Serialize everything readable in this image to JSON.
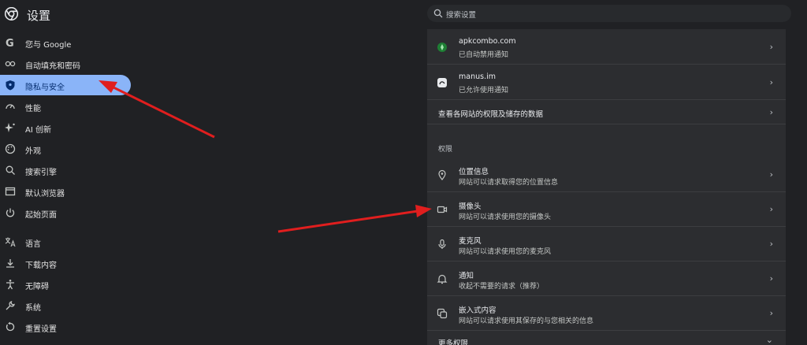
{
  "header": {
    "title": "设置",
    "logo": "chrome-logo"
  },
  "search": {
    "placeholder": "搜索设置"
  },
  "sidebar": {
    "items": [
      {
        "label": "您与 Google",
        "icon": "google-g-icon"
      },
      {
        "label": "自动填充和密码",
        "icon": "key-icon"
      },
      {
        "label": "隐私与安全",
        "icon": "shield-icon",
        "selected": true
      },
      {
        "label": "性能",
        "icon": "speedometer-icon"
      },
      {
        "label": "AI 创新",
        "icon": "sparkle-icon"
      },
      {
        "label": "外观",
        "icon": "palette-icon"
      },
      {
        "label": "搜索引擎",
        "icon": "search-icon"
      },
      {
        "label": "默认浏览器",
        "icon": "browser-window-icon"
      },
      {
        "label": "起始页面",
        "icon": "power-icon"
      },
      {
        "label": "语言",
        "icon": "translate-icon"
      },
      {
        "label": "下载内容",
        "icon": "download-icon"
      },
      {
        "label": "无障碍",
        "icon": "accessibility-icon"
      },
      {
        "label": "系统",
        "icon": "wrench-icon"
      },
      {
        "label": "重置设置",
        "icon": "reset-icon"
      }
    ]
  },
  "content": {
    "sites": [
      {
        "title": "apkcombo.com",
        "subtitle": "已自动禁用通知",
        "icon": "site-favicon-icon"
      },
      {
        "title": "manus.im",
        "subtitle": "已允许使用通知",
        "icon": "site-favicon-icon"
      }
    ],
    "view_all": "查看各网站的权限及储存的数据",
    "permissions_header": "权限",
    "permissions": [
      {
        "title": "位置信息",
        "subtitle": "网站可以请求取得您的位置信息",
        "icon": "location-pin-icon"
      },
      {
        "title": "摄像头",
        "subtitle": "网站可以请求使用您的摄像头",
        "icon": "camera-icon"
      },
      {
        "title": "麦克风",
        "subtitle": "网站可以请求使用您的麦克风",
        "icon": "microphone-icon"
      },
      {
        "title": "通知",
        "subtitle": "收起不需要的请求（推荐）",
        "icon": "bell-icon"
      },
      {
        "title": "嵌入式内容",
        "subtitle": "网站可以请求使用其保存的与您相关的信息",
        "icon": "embedded-content-icon"
      }
    ],
    "more_permissions": "更多权限"
  },
  "colors": {
    "background": "#202124",
    "panel": "#2c2d30",
    "selected": "#8ab4f8",
    "annotation": "#e01e1e"
  }
}
